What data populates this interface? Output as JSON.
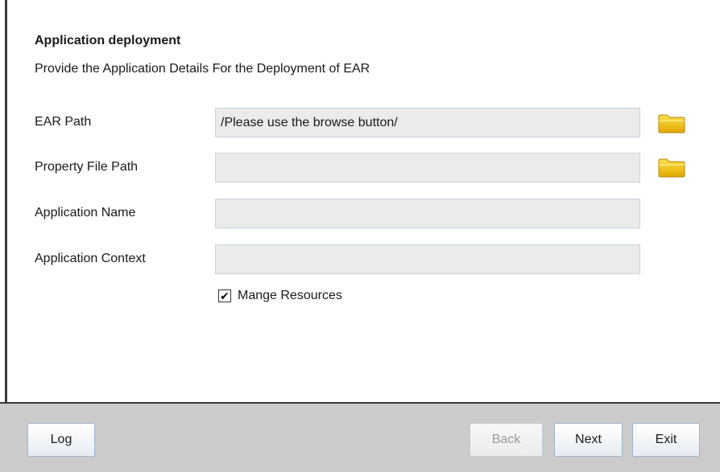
{
  "panel": {
    "title": "Application deployment",
    "description": "Provide the Application Details For the Deployment of EAR"
  },
  "fields": {
    "ear_path": {
      "label": "EAR Path",
      "value": "/Please use the browse button/"
    },
    "property_file_path": {
      "label": "Property File Path",
      "value": ""
    },
    "application_name": {
      "label": "Application Name",
      "value": ""
    },
    "application_context": {
      "label": "Application Context",
      "value": ""
    }
  },
  "options": {
    "manage_resources": {
      "label": "Mange Resources",
      "checked": true,
      "check_mark": "✔"
    }
  },
  "footer": {
    "log_label": "Log",
    "back_label": "Back",
    "next_label": "Next",
    "exit_label": "Exit"
  },
  "icons": {
    "browse": "folder-icon"
  },
  "colors": {
    "input_background": "#ebebeb",
    "footer_background": "#cbcbcb",
    "folder_yellow": "#f2c200"
  }
}
